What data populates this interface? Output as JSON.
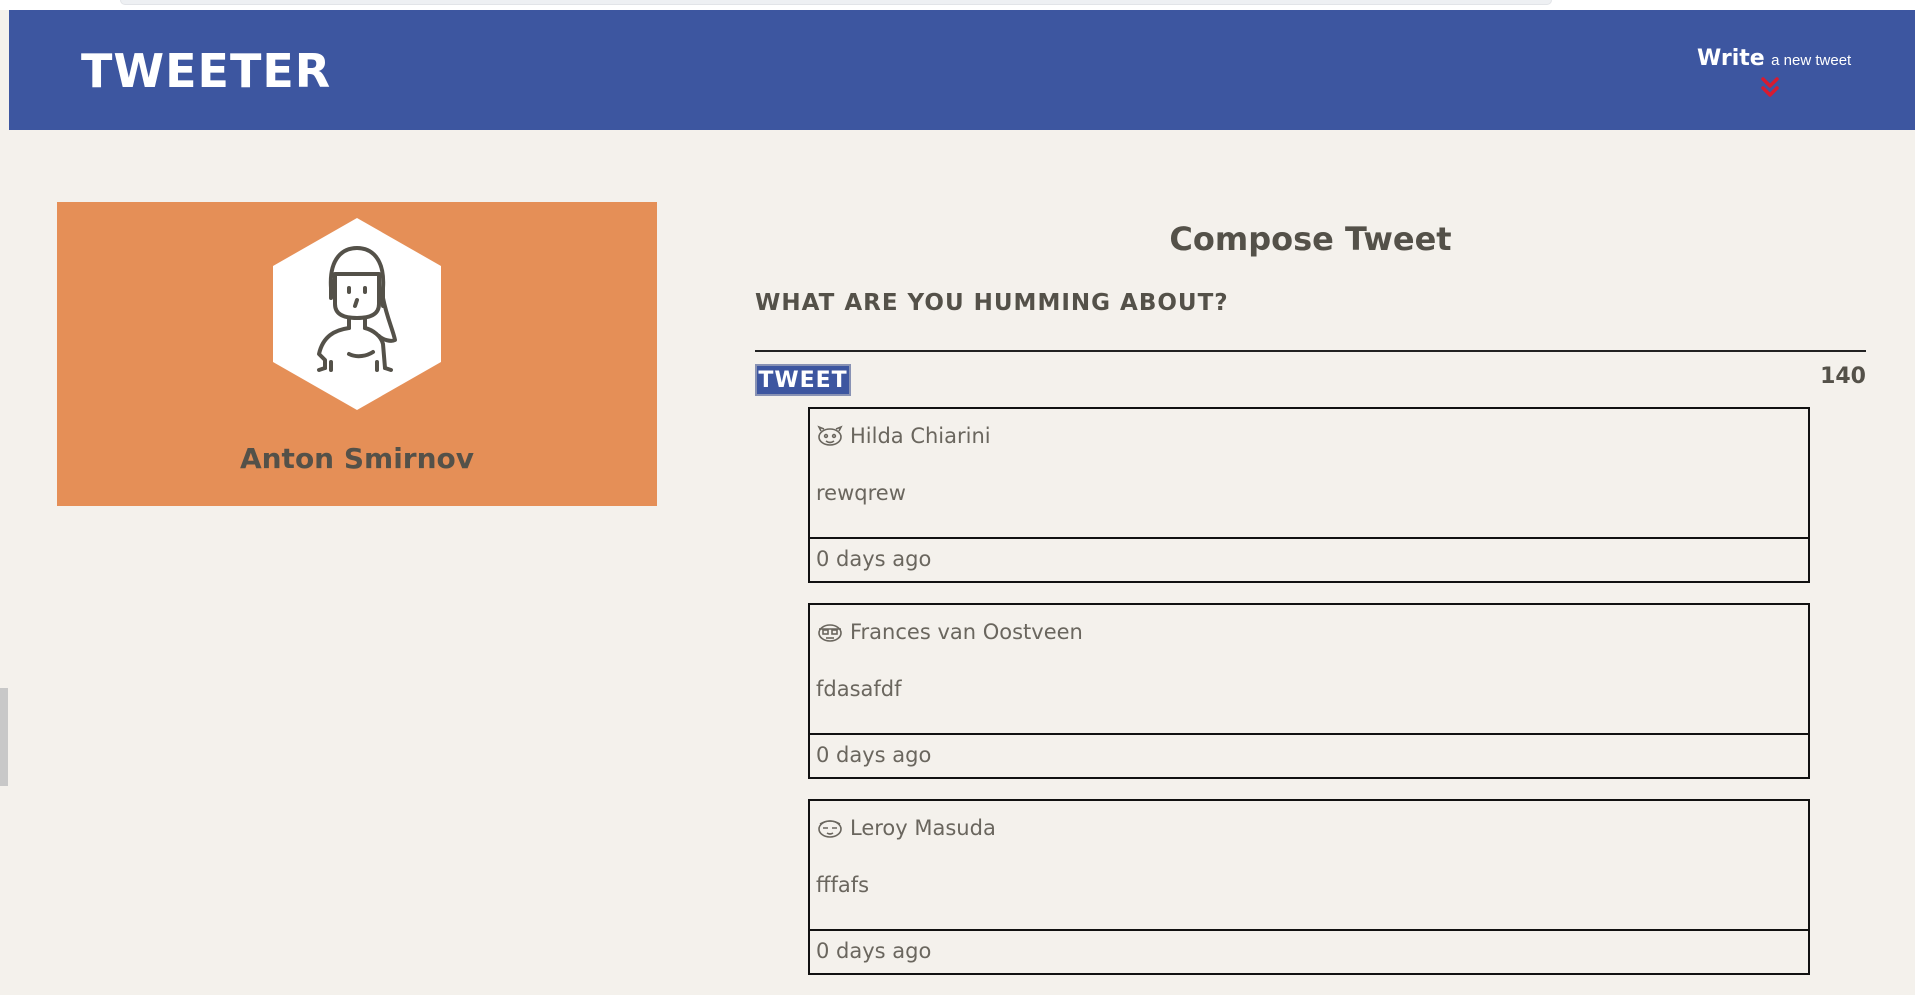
{
  "nav": {
    "logo": "TWEETER",
    "compose_toggle": {
      "write_label": "Write",
      "sub_label": "a new tweet",
      "arrow_icon": "double-chevron-down-icon",
      "arrow_color": "#d81b30"
    }
  },
  "profile": {
    "name": "Anton Smirnov",
    "avatar_icon": "user-avatar-icon",
    "card_color": "#e58f57"
  },
  "compose": {
    "title": "Compose Tweet",
    "prompt": "What are you humming about?",
    "tweet_button": "TWEET",
    "char_counter": "140"
  },
  "tweets": [
    {
      "user_name": "Hilda Chiarini",
      "icon": "avatar-face-icon",
      "content": "rewqrew",
      "timestamp": "0 days ago"
    },
    {
      "user_name": "Frances van Oostveen",
      "icon": "avatar-face-icon",
      "content": "fdasafdf",
      "timestamp": "0 days ago"
    },
    {
      "user_name": "Leroy Masuda",
      "icon": "avatar-face-icon",
      "content": "fffafs",
      "timestamp": "0 days ago"
    }
  ],
  "colors": {
    "navbar": "#3d56a0",
    "background": "#f4f1ec",
    "text": "#545149"
  }
}
